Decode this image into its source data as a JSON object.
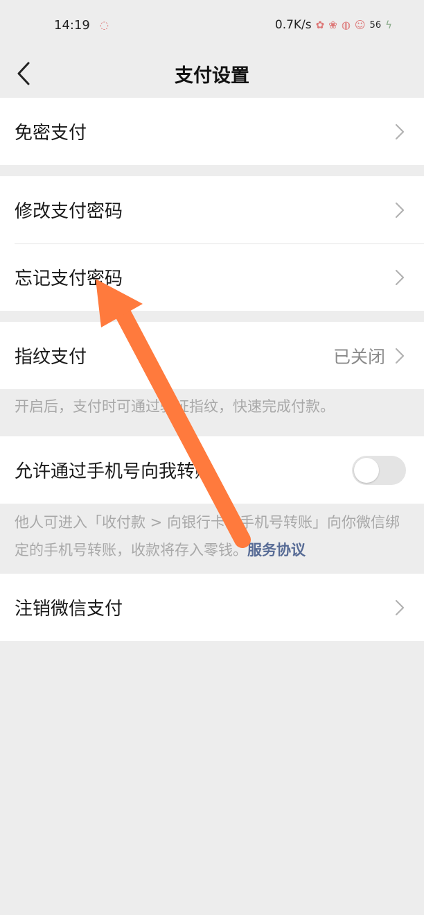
{
  "status_bar": {
    "time": "14:19",
    "network_speed": "0.7K/s",
    "battery": "56"
  },
  "nav": {
    "title": "支付设置"
  },
  "settings": {
    "passwordless_pay": "免密支付",
    "change_pay_password": "修改支付密码",
    "forgot_pay_password": "忘记支付密码",
    "fingerprint_pay": "指纹支付",
    "fingerprint_status": "已关闭",
    "fingerprint_note": "开启后，支付时可通过验证指纹，快速完成付款。",
    "phone_transfer": "允许通过手机号向我转账",
    "phone_transfer_enabled": false,
    "phone_transfer_note": "他人可进入「收付款 > 向银行卡或手机号转账」向你微信绑定的手机号转账，收款将存入零钱。",
    "service_agreement_link": "服务协议",
    "cancel_wechat_pay": "注销微信支付"
  },
  "colors": {
    "background": "#ededed",
    "link": "#576b95",
    "annotation_arrow": "#ff7a3d"
  }
}
